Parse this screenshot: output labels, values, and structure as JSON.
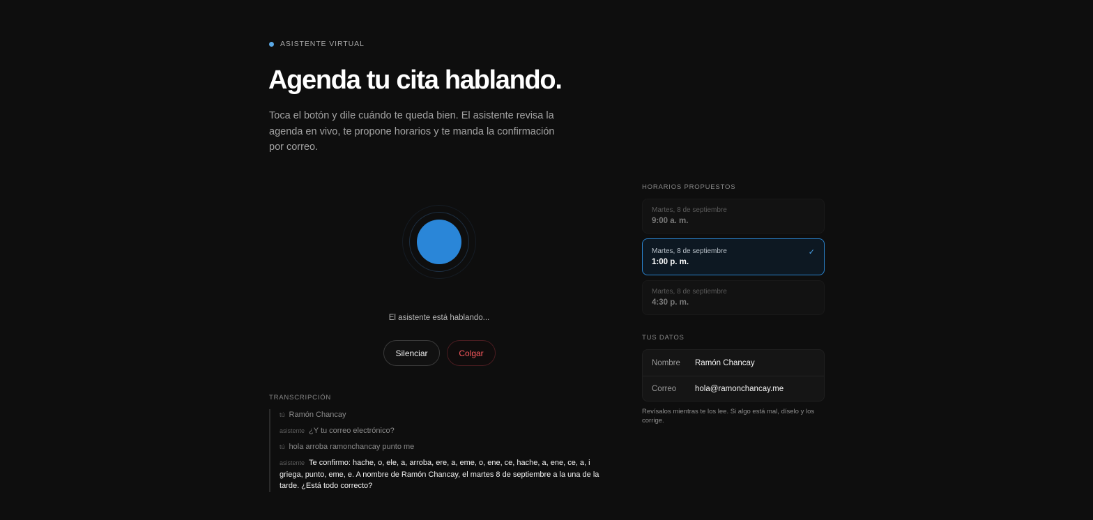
{
  "header": {
    "eyebrow": "ASISTENTE VIRTUAL",
    "title": "Agenda tu cita hablando.",
    "subtitle": "Toca el botón y dile cuándo te queda bien. El asistente revisa la agenda en vivo, te propone horarios y te manda la confirmación por correo."
  },
  "call": {
    "status": "El asistente está hablando...",
    "mute_label": "Silenciar",
    "hangup_label": "Colgar"
  },
  "transcript": {
    "label": "TRANSCRIPCIÓN",
    "lines": [
      {
        "speaker": "tú",
        "text": "Ramón Chancay"
      },
      {
        "speaker": "asistente",
        "text": "¿Y tu correo electrónico?"
      },
      {
        "speaker": "tú",
        "text": "hola arroba ramonchancay punto me"
      },
      {
        "speaker": "asistente",
        "text": "Te confirmo: hache, o, ele, a, arroba, ere, a, eme, o, ene, ce, hache, a, ene, ce, a, i griega, punto, eme, e. A nombre de Ramón Chancay, el martes 8 de septiembre a la una de la tarde. ¿Está todo correcto?"
      }
    ]
  },
  "slots": {
    "label": "HORARIOS PROPUESTOS",
    "items": [
      {
        "date": "Martes, 8 de septiembre",
        "time": "9:00 a. m.",
        "selected": false
      },
      {
        "date": "Martes, 8 de septiembre",
        "time": "1:00 p. m.",
        "selected": true
      },
      {
        "date": "Martes, 8 de septiembre",
        "time": "4:30 p. m.",
        "selected": false
      }
    ],
    "selected_icon": "check-icon"
  },
  "details": {
    "label": "TUS DATOS",
    "name_key": "Nombre",
    "name_value": "Ramón Chancay",
    "email_key": "Correo",
    "email_value": "hola@ramonchancay.me",
    "note": "Revísalos mientras te los lee. Si algo está mal, díselo y los corrige."
  },
  "colors": {
    "background": "#0e0e0e",
    "accent": "#2a86d8",
    "danger": "#ff5a5f"
  }
}
